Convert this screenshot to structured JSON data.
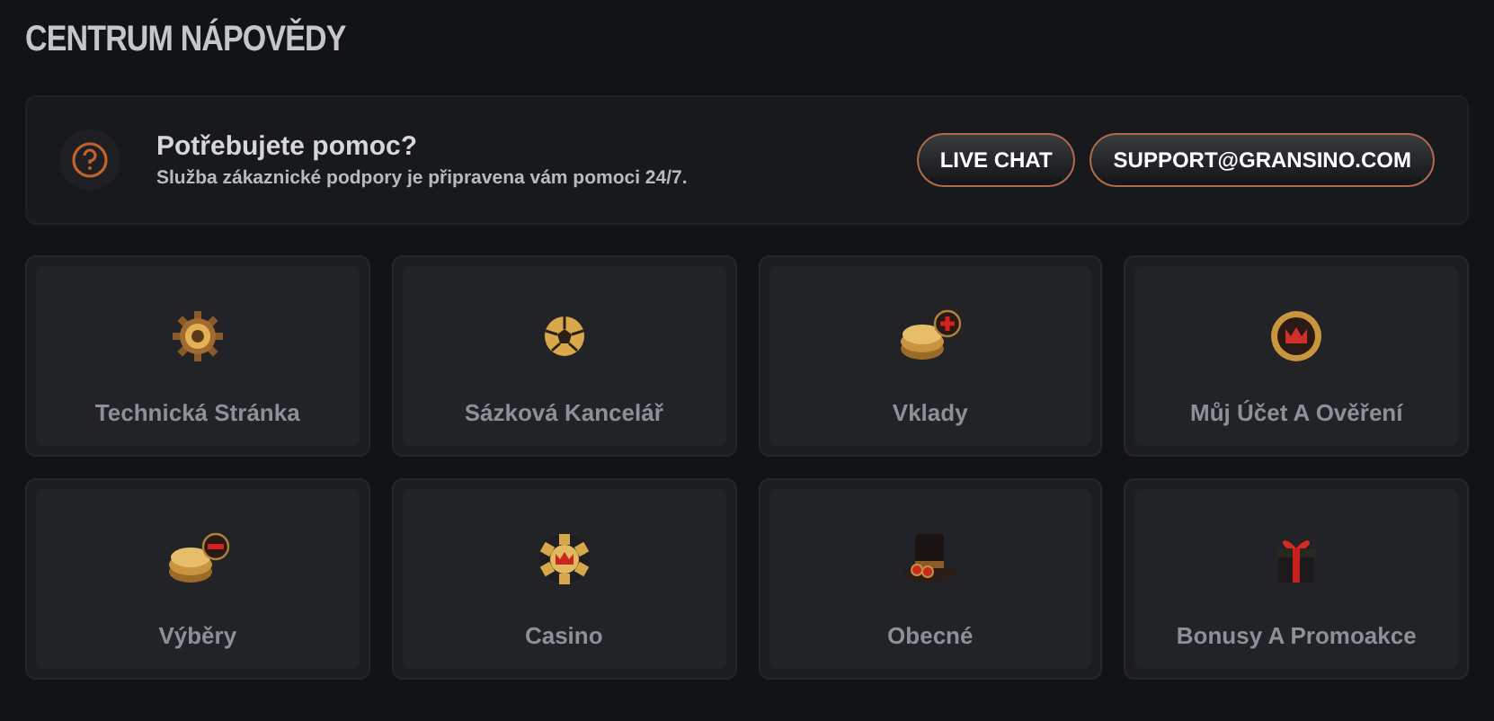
{
  "title": "CENTRUM NÁPOVĚDY",
  "help_banner": {
    "heading": "Potřebujete pomoc?",
    "text": "Služba zákaznické podpory je připravena vám pomoci 24/7.",
    "buttons": [
      "LIVE CHAT",
      "SUPPORT@GRANSINO.COM"
    ]
  },
  "categories": [
    {
      "label": "Technická Stránka"
    },
    {
      "label": "Sázková Kancelář"
    },
    {
      "label": "Vklady"
    },
    {
      "label": "Můj Účet A Ověření"
    },
    {
      "label": "Výběry"
    },
    {
      "label": "Casino"
    },
    {
      "label": "Obecné"
    },
    {
      "label": "Bonusy A Promoakce"
    }
  ]
}
